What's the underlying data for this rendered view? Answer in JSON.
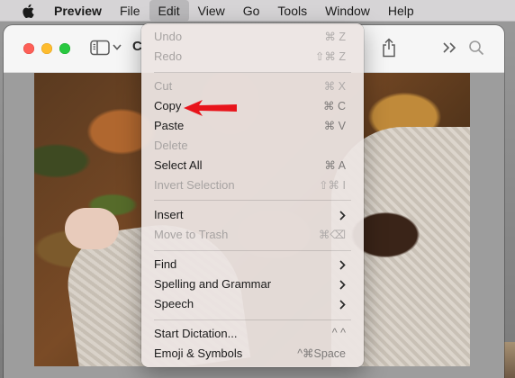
{
  "menubar": {
    "app_name": "Preview",
    "items": [
      "File",
      "Edit",
      "View",
      "Go",
      "Tools",
      "Window",
      "Help"
    ]
  },
  "window": {
    "title_fragment": "C"
  },
  "edit_menu": {
    "undo": {
      "label": "Undo",
      "shortcut": "⌘ Z"
    },
    "redo": {
      "label": "Redo",
      "shortcut": "⇧⌘ Z"
    },
    "cut": {
      "label": "Cut",
      "shortcut": "⌘ X"
    },
    "copy": {
      "label": "Copy",
      "shortcut": "⌘ C"
    },
    "paste": {
      "label": "Paste",
      "shortcut": "⌘ V"
    },
    "delete": {
      "label": "Delete"
    },
    "select_all": {
      "label": "Select All",
      "shortcut": "⌘ A"
    },
    "invert_selection": {
      "label": "Invert Selection",
      "shortcut": "⇧⌘ I"
    },
    "insert": {
      "label": "Insert"
    },
    "move_to_trash": {
      "label": "Move to Trash",
      "shortcut": "⌘⌫"
    },
    "find": {
      "label": "Find"
    },
    "spelling_and_grammar": {
      "label": "Spelling and Grammar"
    },
    "speech": {
      "label": "Speech"
    },
    "start_dictation": {
      "label": "Start Dictation...",
      "shortcut": "^ ^"
    },
    "emoji_and_symbols": {
      "label": "Emoji & Symbols",
      "shortcut": "^⌘Space"
    }
  },
  "icons": {
    "apple": "apple-logo-icon",
    "sidebar": "sidebar-toggle-icon",
    "share": "share-icon",
    "more": "chevron-double-right-icon",
    "search": "search-icon",
    "annotation": "red-arrow-icon"
  },
  "colors": {
    "annotation_arrow": "#e8141b",
    "traffic_close": "#fd5f57",
    "traffic_minimize": "#febc2e",
    "traffic_zoom": "#28c840"
  }
}
